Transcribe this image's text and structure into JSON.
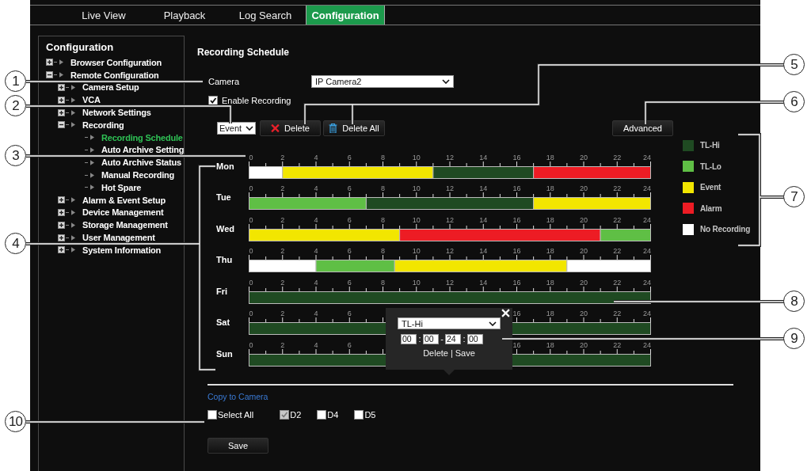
{
  "nav": {
    "tabs": [
      {
        "label": "Live View",
        "selected": false
      },
      {
        "label": "Playback",
        "selected": false
      },
      {
        "label": "Log Search",
        "selected": false
      },
      {
        "label": "Configuration",
        "selected": true
      }
    ]
  },
  "sidebar": {
    "title": "Configuration",
    "tree": [
      {
        "label": "Browser Configuration",
        "expanded": false,
        "selected": false
      },
      {
        "label": "Remote Configuration",
        "expanded": true,
        "selected": false,
        "children": [
          {
            "label": "Camera Setup",
            "expanded": false,
            "selected": false
          },
          {
            "label": "VCA",
            "expanded": false,
            "selected": false
          },
          {
            "label": "Network Settings",
            "expanded": false,
            "selected": false
          },
          {
            "label": "Recording",
            "expanded": true,
            "selected": false,
            "children": [
              {
                "label": "Recording Schedule",
                "selected": true
              },
              {
                "label": "Auto Archive Setting",
                "selected": false
              },
              {
                "label": "Auto Archive Status",
                "selected": false
              },
              {
                "label": "Manual Recording",
                "selected": false
              },
              {
                "label": "Hot Spare",
                "selected": false
              }
            ]
          },
          {
            "label": "Alarm & Event Setup",
            "expanded": false,
            "selected": false
          },
          {
            "label": "Device Management",
            "expanded": false,
            "selected": false
          },
          {
            "label": "Storage Management",
            "expanded": false,
            "selected": false
          },
          {
            "label": "User Management",
            "expanded": false,
            "selected": false
          },
          {
            "label": "System Information",
            "expanded": false,
            "selected": false
          }
        ]
      }
    ]
  },
  "page": {
    "title": "Recording Schedule",
    "camera": {
      "label": "Camera",
      "value": "IP Camera2"
    },
    "enable_recording": {
      "label": "Enable Recording",
      "checked": true
    },
    "mode_select": {
      "value": "Event"
    },
    "buttons": [
      {
        "kind": "delete",
        "label": "Delete"
      },
      {
        "kind": "delete_all",
        "label": "Delete All"
      },
      {
        "kind": "advanced",
        "label": "Advanced"
      }
    ]
  },
  "schedule": {
    "days": [
      {
        "chart_data": {
          "type": "bar",
          "orientation": "horizontal",
          "stacked": true,
          "categories": [
            "Mon"
          ],
          "xlim": [
            0,
            24
          ],
          "xticks": [
            0,
            2,
            4,
            6,
            8,
            10,
            12,
            14,
            16,
            18,
            20,
            22,
            24
          ],
          "series": [
            {
              "color": "#ffffff",
              "values": [
                2
              ]
            },
            {
              "color": "#f2e600",
              "values": [
                9
              ]
            },
            {
              "color": "#1f4a22",
              "values": [
                6
              ]
            },
            {
              "color": "#ed1c24",
              "values": [
                7
              ]
            }
          ]
        }
      },
      {
        "chart_data": {
          "type": "bar",
          "orientation": "horizontal",
          "stacked": true,
          "categories": [
            "Tue"
          ],
          "xlim": [
            0,
            24
          ],
          "xticks": [
            0,
            2,
            4,
            6,
            8,
            10,
            12,
            14,
            16,
            18,
            20,
            22,
            24
          ],
          "series": [
            {
              "color": "#5fbf45",
              "values": [
                7
              ]
            },
            {
              "color": "#1f4a22",
              "values": [
                10
              ]
            },
            {
              "color": "#f2e600",
              "values": [
                7
              ]
            }
          ]
        }
      },
      {
        "chart_data": {
          "type": "bar",
          "orientation": "horizontal",
          "stacked": true,
          "categories": [
            "Wed"
          ],
          "xlim": [
            0,
            24
          ],
          "xticks": [
            0,
            2,
            4,
            6,
            8,
            10,
            12,
            14,
            16,
            18,
            20,
            22,
            24
          ],
          "series": [
            {
              "color": "#f2e600",
              "values": [
                9
              ]
            },
            {
              "color": "#ed1c24",
              "values": [
                12
              ]
            },
            {
              "color": "#5fbf45",
              "values": [
                3
              ]
            }
          ]
        }
      },
      {
        "chart_data": {
          "type": "bar",
          "orientation": "horizontal",
          "stacked": true,
          "categories": [
            "Thu"
          ],
          "xlim": [
            0,
            24
          ],
          "xticks": [
            0,
            2,
            4,
            6,
            8,
            10,
            12,
            14,
            16,
            18,
            20,
            22,
            24
          ],
          "series": [
            {
              "color": "#ffffff",
              "values": [
                4
              ]
            },
            {
              "color": "#5fbf45",
              "values": [
                4.7
              ]
            },
            {
              "color": "#f2e600",
              "values": [
                10.3
              ]
            },
            {
              "color": "#ffffff",
              "values": [
                5
              ]
            }
          ]
        }
      },
      {
        "chart_data": {
          "type": "bar",
          "orientation": "horizontal",
          "stacked": true,
          "categories": [
            "Fri"
          ],
          "xlim": [
            0,
            24
          ],
          "xticks": [
            0,
            2,
            4,
            6,
            8,
            10,
            12,
            14,
            16,
            18,
            20,
            22,
            24
          ],
          "series": [
            {
              "color": "#1f4a22",
              "values": [
                24
              ]
            }
          ]
        }
      },
      {
        "chart_data": {
          "type": "bar",
          "orientation": "horizontal",
          "stacked": true,
          "categories": [
            "Sat"
          ],
          "xlim": [
            0,
            24
          ],
          "xticks": [
            0,
            2,
            4,
            6,
            16,
            18,
            20,
            22,
            24
          ],
          "series": [
            {
              "color": "#1f4a22",
              "values": [
                24
              ]
            }
          ]
        }
      },
      {
        "chart_data": {
          "type": "bar",
          "orientation": "horizontal",
          "stacked": true,
          "categories": [
            "Sun"
          ],
          "xlim": [
            0,
            24
          ],
          "xticks": [
            0,
            2,
            4,
            6,
            16,
            18,
            20,
            22,
            24
          ],
          "series": [
            {
              "color": "#1f4a22",
              "values": [
                24
              ]
            }
          ]
        }
      }
    ]
  },
  "legend": [
    {
      "label": "TL-Hi",
      "color": "#1f4a22"
    },
    {
      "label": "TL-Lo",
      "color": "#5fbf45"
    },
    {
      "label": "Event",
      "color": "#f2e600"
    },
    {
      "label": "Alarm",
      "color": "#ed1c24"
    },
    {
      "label": "No Recording",
      "color": "#ffffff"
    }
  ],
  "popup": {
    "type_value": "TL-Hi",
    "start_hour": "00",
    "start_minute": "00",
    "end_hour": "24",
    "end_minute": "00",
    "separators": [
      ":",
      "-",
      ":"
    ],
    "delete": "Delete",
    "divider": "|",
    "save": "Save"
  },
  "copy": {
    "title": "Copy to Camera",
    "options": [
      {
        "label": "Select All",
        "checked": false,
        "disabled": false
      },
      {
        "label": "D2",
        "checked": true,
        "disabled": true
      },
      {
        "label": "D4",
        "checked": false,
        "disabled": false
      },
      {
        "label": "D5",
        "checked": false,
        "disabled": false
      }
    ],
    "save": "Save"
  },
  "callouts": [
    {
      "label": "1"
    },
    {
      "label": "2"
    },
    {
      "label": "3"
    },
    {
      "label": "4"
    },
    {
      "label": "10"
    },
    {
      "label": "5"
    },
    {
      "label": "6"
    },
    {
      "label": "7"
    },
    {
      "label": "8"
    },
    {
      "label": "9"
    }
  ]
}
